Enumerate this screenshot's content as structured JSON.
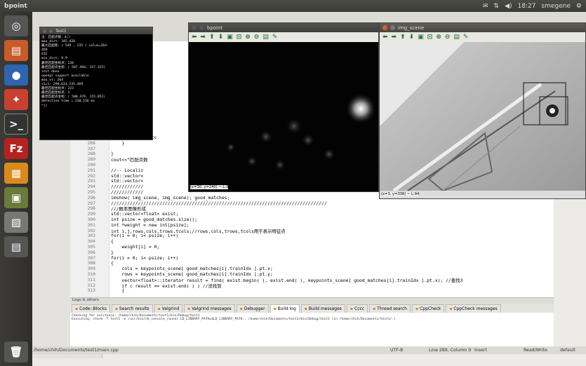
{
  "topbar": {
    "app_name": "bpoint",
    "time": "18:27",
    "user": "smegene"
  },
  "launcher": {
    "icons": [
      "dash-icon",
      "files-icon",
      "firefox-icon",
      "settings-icon",
      "terminal-icon",
      "filezilla-icon",
      "software-center-icon",
      "codeblocks-icon",
      "system-monitor-icon",
      "workspace-icon",
      "trash-icon"
    ]
  },
  "terminal_window": {
    "title": "Test1",
    "lines": [
      "注：匹配点数：4()",
      "max_dist: 345.428",
      "最大匹配距：( 549 , 235 )  value=264",
      "469",
      "432",
      "min_dist: 9.9",
      "最佳匹配坐标点：228",
      "最佳匹配点坐标：( 587.494, 157.325)",
      "init done",
      "opengl support available",
      "max_vl: 364",
      "x1=1: 298,631,235,469",
      "最佳匹配坐标点：223",
      "最佳匹配坐标点：1",
      "最佳匹配点坐标：( 588.479, 155.852)",
      "detection time = 230,156 ms",
      "^[["
    ]
  },
  "bpoint_window": {
    "title": "bpoint",
    "coords": "(x=30, y=240) ~ L:3"
  },
  "scene_window": {
    "title": "img_scene",
    "coords": "(x=3, y=338) ~ L:94"
  },
  "code_lines": [
    {
      "n": "285",
      "t": "        good_matc"
    },
    {
      "n": "286",
      "t": "    }"
    },
    {
      "n": "287",
      "t": ""
    },
    {
      "n": "288",
      "t": "}"
    },
    {
      "n": "289",
      "t": "cout<<\"匹配点数"
    },
    {
      "n": "290",
      "t": ""
    },
    {
      "n": "291",
      "t": "//-- Localiz"
    },
    {
      "n": "292",
      "t": "std::vector<"
    },
    {
      "n": "293",
      "t": "std::vector<"
    },
    {
      "n": "294",
      "t": "////////////"
    },
    {
      "n": "295",
      "t": "////////////"
    },
    {
      "n": "296",
      "t": "imshow( img_scene, img_scene); good_matches;"
    },
    {
      "n": "297",
      "t": "////////////////////////////////////////////////////////////////////////////////"
    },
    {
      "n": "298",
      "t": "///概率图像形成"
    },
    {
      "n": "299",
      "t": "std::vector<float> exist;"
    },
    {
      "n": "300",
      "t": "int psize = good_matches.size();"
    },
    {
      "n": "301",
      "t": "int *weight = new int[psize];"
    },
    {
      "n": "302",
      "t": "int i,j,rows,cols,trows,tcols;//rows,cols,trows,tcols用于表示特征点"
    },
    {
      "n": "303",
      "t": "for(i = 0; i< psize; i++)"
    },
    {
      "n": "304",
      "t": "{"
    },
    {
      "n": "305",
      "t": "    weight[i] = 0;"
    },
    {
      "n": "306",
      "t": "}"
    },
    {
      "n": "307",
      "t": "for(i = 0; i< psize; i++)"
    },
    {
      "n": "308",
      "t": "{"
    },
    {
      "n": "309",
      "t": "    cols = keypoints_scene[ good_matches[i].trainIdx ].pt.x;"
    },
    {
      "n": "310",
      "t": "    rows = keypoints_scene[ good_matches[i].trainIdx ].pt.y;"
    },
    {
      "n": "311",
      "t": "    vector<float>::iterator result = find( exist.begin( ), exist.end( ), keypoints_scene[ good_matches[i].trainIdx ].pt.x); //查找3"
    },
    {
      "n": "312",
      "t": "    if ( result == exist.end( ) ) //没找到"
    },
    {
      "n": "313",
      "t": "    {"
    }
  ],
  "logs": {
    "title": "Logs & others",
    "tabs": [
      "Code::Blocks",
      "Search results",
      "Valgrind",
      "Valgrind messages",
      "Debugger",
      "Build log",
      "Build messages",
      "Cccc",
      "Thread search",
      "CppCheck",
      "CppCheck messages"
    ],
    "active_tab": "Build log",
    "text": [
      "Checking for existence: /home/chih/Documents/test1/bin/Debug/test1",
      "Executing: xterm -T test1 -e /usr/bin/cb_console_runner LD_LIBRARY_PATH=$LD_LIBRARY_PATH:. /home/chih/Documents/test1/bin/Debug/test1  (in /home/chih/Documents/test1/.)"
    ]
  },
  "statusbar": {
    "path": "/home/chih/Documents/test1/main.cpp",
    "encoding": "UTF-8",
    "position": "Line 289, Column 9",
    "mode": "Insert",
    "access": "Read/Write",
    "lang": "default"
  }
}
